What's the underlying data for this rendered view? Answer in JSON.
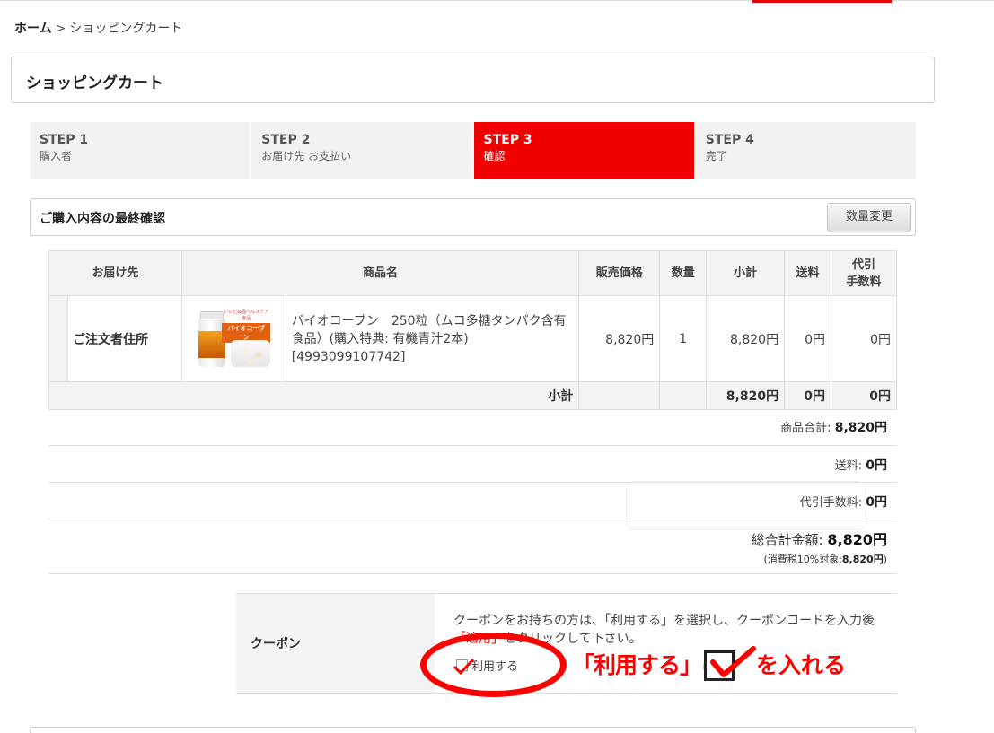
{
  "breadcrumb": {
    "home": "ホーム",
    "separator": ">",
    "current": "ショッピングカート"
  },
  "page_title": "ショッピングカート",
  "steps": [
    {
      "num": "STEP 1",
      "label": "購入者",
      "active": false
    },
    {
      "num": "STEP 2",
      "label": "お届け先 お支払い",
      "active": false
    },
    {
      "num": "STEP 3",
      "label": "確認",
      "active": true
    },
    {
      "num": "STEP 4",
      "label": "完了",
      "active": false
    }
  ],
  "confirm": {
    "label": "ご購入内容の最終確認",
    "change_qty_button": "数量変更"
  },
  "table": {
    "headers": {
      "dest": "お届け先",
      "product": "商品名",
      "price": "販売価格",
      "qty": "数量",
      "subtotal": "小計",
      "shipping": "送料",
      "cod_fee_line1": "代引",
      "cod_fee_line2": "手数料"
    },
    "row": {
      "dest": "ご注文者住所",
      "product_image_banner_small": "いいだ薬品ヘルスケア食品",
      "product_image_banner": "バイオコーブン",
      "product_name": "バイオコーブン　250粒（ムコ多糖タンパク含有食品）(購入特典: 有機青汁2本) [4993099107742]",
      "price": "8,820円",
      "qty": "1",
      "subtotal": "8,820円",
      "shipping": "0円",
      "cod_fee": "0円"
    },
    "subtotal_row": {
      "label": "小計",
      "subtotal": "8,820円",
      "shipping": "0円",
      "cod_fee": "0円"
    }
  },
  "summary": {
    "product_total_label": "商品合計:",
    "product_total": "8,820円",
    "shipping_label": "送料:",
    "shipping": "0円",
    "cod_fee_label": "代引手数料:",
    "cod_fee": "0円",
    "grand_total_label": "総合計金額:",
    "grand_total": "8,820円",
    "tax_note_prefix": "(消費税10%対象:",
    "tax_note_value": "8,820円",
    "tax_note_suffix": ")"
  },
  "coupon": {
    "label": "クーポン",
    "text_part1": "クーポンをお持ちの方は、「利用する」を選択し、クーポンコードを入力後",
    "text_apply": "「適用」",
    "text_part2": "をクリックして下さい。",
    "option_label": "利用する"
  },
  "annotation": {
    "text_before": "「利用する」に",
    "text_after": "を入れる",
    "color": "#ff0000"
  },
  "colors": {
    "accent": "#f00000",
    "header_bg": "#f3f3f3",
    "border": "#dddddd"
  }
}
